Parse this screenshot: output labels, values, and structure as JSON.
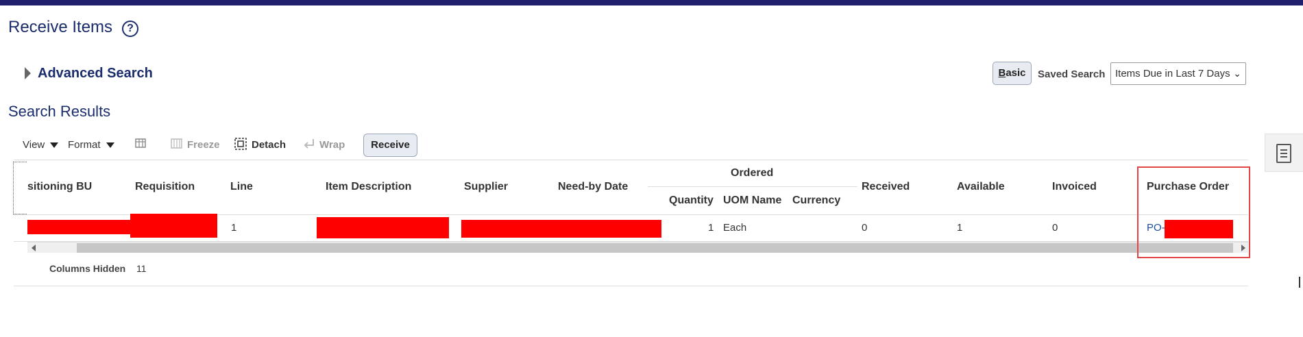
{
  "header": {
    "title": "Receive Items",
    "help_icon": "?"
  },
  "search": {
    "advanced_label": "Advanced Search",
    "basic_label_underlined": "B",
    "basic_label_rest": "asic",
    "saved_search_label": "Saved Search",
    "saved_search_value": "Items Due in Last 7 Days"
  },
  "results": {
    "title": "Search Results",
    "toolbar": {
      "view": "View",
      "format": "Format",
      "freeze": "Freeze",
      "detach": "Detach",
      "wrap": "Wrap",
      "receive": "Receive"
    },
    "columns": {
      "business_unit": "sitioning BU",
      "requisition": "Requisition",
      "line": "Line",
      "item_description": "Item Description",
      "supplier": "Supplier",
      "need_by_date": "Need-by Date",
      "ordered_group": "Ordered",
      "quantity": "Quantity",
      "uom_name": "UOM Name",
      "currency": "Currency",
      "received": "Received",
      "available": "Available",
      "invoiced": "Invoiced",
      "purchase_order": "Purchase Order"
    },
    "rows": [
      {
        "line": "1",
        "quantity": "1",
        "uom_name": "Each",
        "received": "0",
        "available": "1",
        "invoiced": "0",
        "purchase_order_prefix": "PO-"
      }
    ],
    "columns_hidden_label": "Columns Hidden",
    "columns_hidden_count": "11"
  },
  "icons": [
    "help-icon",
    "expand-triangle-icon",
    "dropdown-caret-icon",
    "freeze-columns-icon",
    "detach-icon",
    "wrap-icon",
    "scroll-left-icon",
    "scroll-right-icon",
    "document-panel-icon"
  ],
  "colors": {
    "brand_bar": "#1f1f6e",
    "title_text": "#1a2c6b",
    "redaction": "#ff0000",
    "highlight_border": "#e24545"
  }
}
